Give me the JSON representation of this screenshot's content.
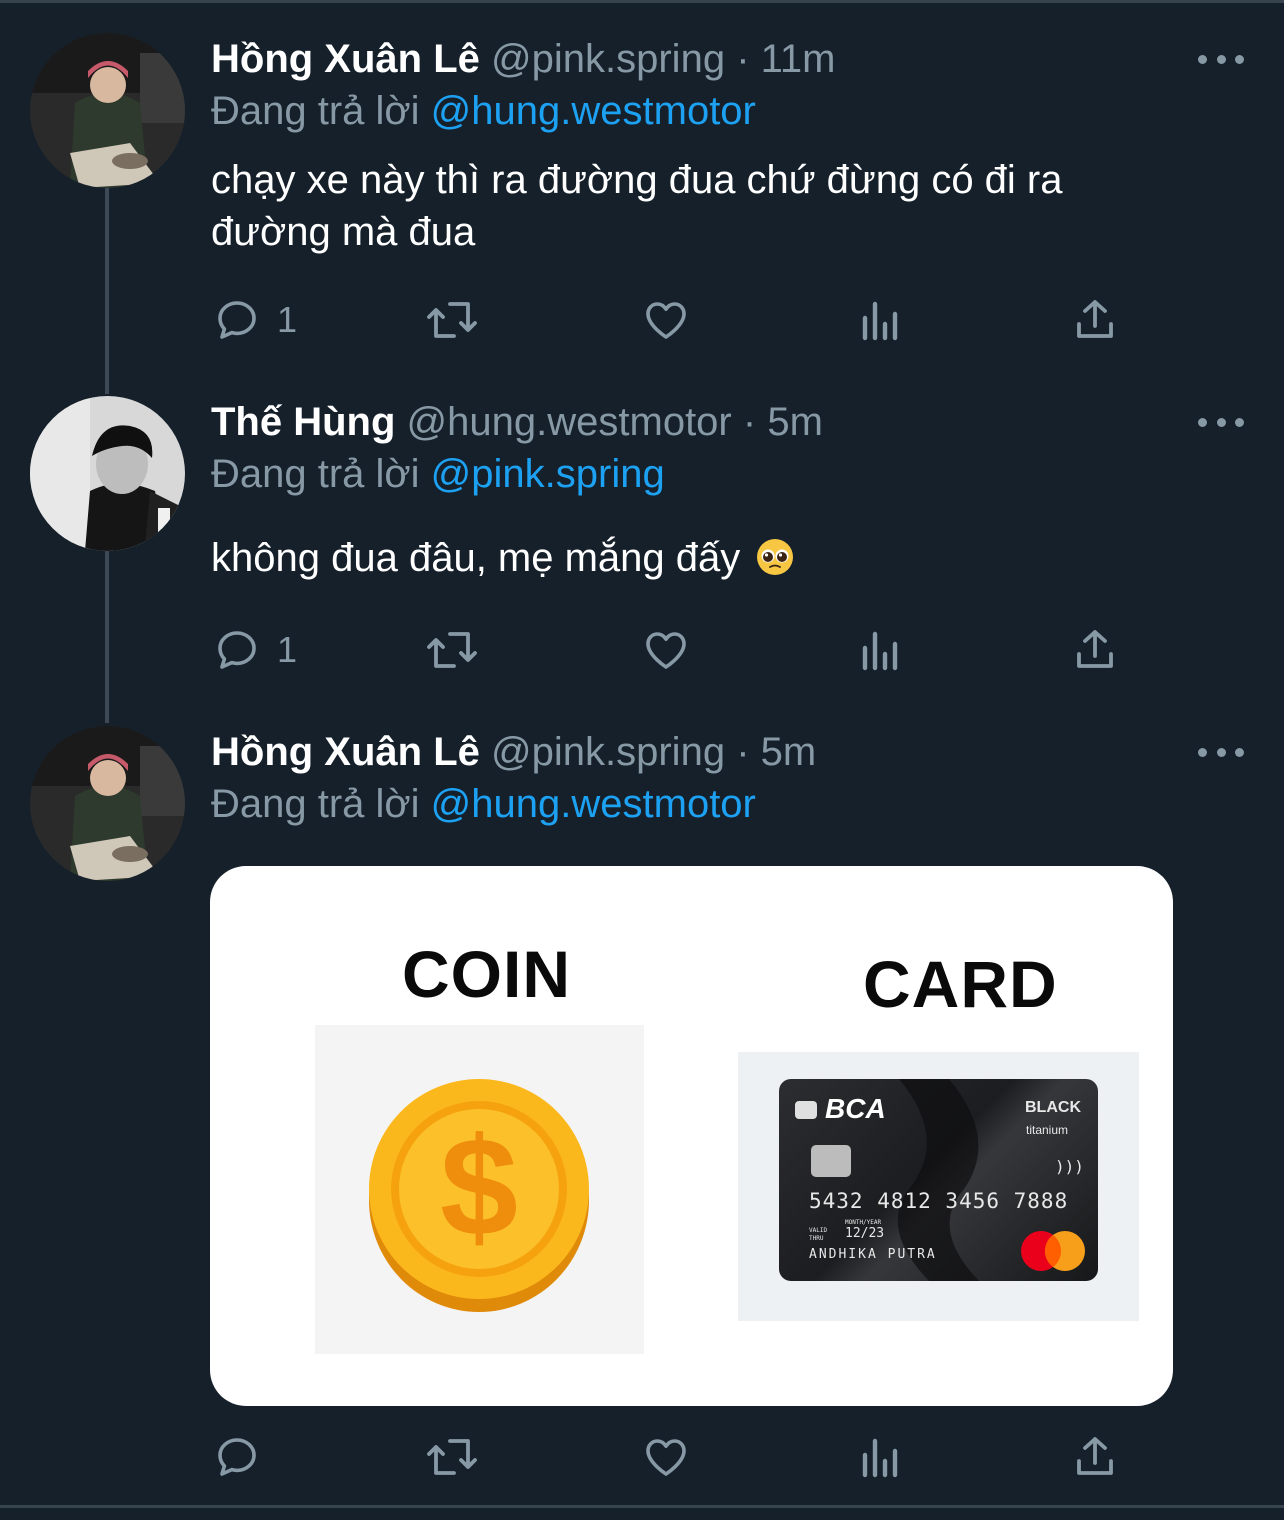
{
  "tweets": [
    {
      "name": "Hồng Xuân Lê",
      "handle": "@pink.spring",
      "separator": "·",
      "time": "11m",
      "replying_prefix": "Đang trả lời",
      "replying_to": "@hung.westmotor",
      "text_line1": "chạy xe này thì ra đường đua chứ đừng có đi ra",
      "text_line2": "đường mà đua",
      "reply_count": "1"
    },
    {
      "name": "Thế Hùng",
      "handle": "@hung.westmotor",
      "separator": "·",
      "time": "5m",
      "replying_prefix": "Đang trả lời",
      "replying_to": "@pink.spring",
      "text": "không đua đâu, mẹ mắng đấy",
      "reply_count": "1"
    },
    {
      "name": "Hồng Xuân Lê",
      "handle": "@pink.spring",
      "separator": "·",
      "time": "5m",
      "replying_prefix": "Đang trả lời",
      "replying_to": "@hung.westmotor",
      "media": {
        "left_title": "COIN",
        "right_title": "CARD",
        "card_bank": "BCA",
        "card_tier": "BLACK",
        "card_subtier": "titanium",
        "card_number": "5432 4812 3456 7888",
        "card_valid_label_1": "VALID",
        "card_valid_label_2": "THRU",
        "card_month_year_label": "MONTH/YEAR",
        "card_expiry": "12/23",
        "card_holder": "ANDHIKA PUTRA"
      }
    }
  ],
  "icons": [
    "reply-icon",
    "retweet-icon",
    "like-icon",
    "analytics-icon",
    "share-icon",
    "more-icon"
  ],
  "colors": {
    "background": "#15202b",
    "secondary_text": "#8899a6",
    "link": "#1da1f2",
    "divider": "#38444d"
  }
}
